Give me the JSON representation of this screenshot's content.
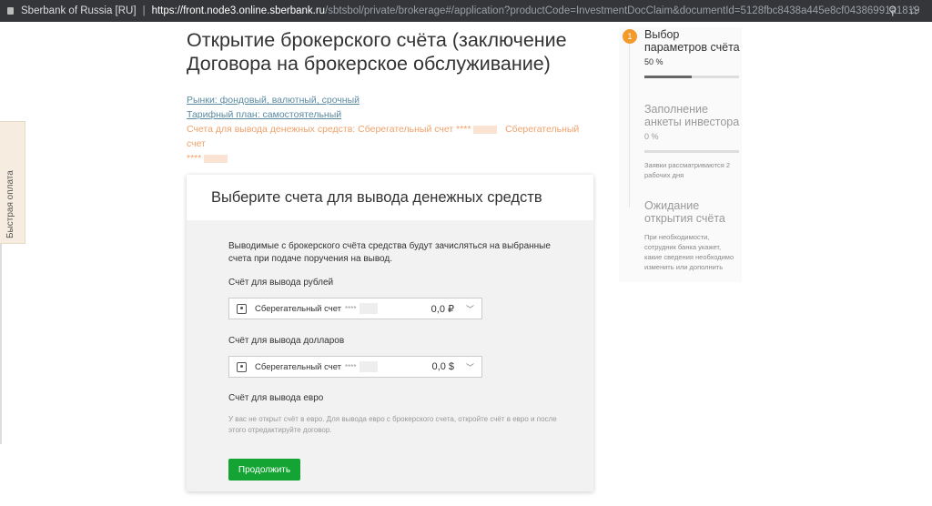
{
  "browser": {
    "site": "Sberbank of Russia [RU]",
    "url_host": "https://front.node3.online.sberbank.ru",
    "url_path": "/sbtsbol/private/brokerage#/application?productCode=InvestmentDocClaim&documentId=5128fbc8438a445e8cf04386991a1819",
    "separator": "|"
  },
  "side_tab": "Быстрая оплата",
  "page": {
    "title": "Открытие брокерского счёта (заключение Договора на брокерское обслуживание)",
    "markets_link": "Рынки: фондовый, валютный, срочный",
    "tariff_link": "Тарифный план: самостоятельный",
    "accounts_prefix": "Счета для вывода денежных средств: Сберегательный счет ****",
    "accounts_mid": "Сберегательный счет",
    "accounts_suffix": "****"
  },
  "card": {
    "title": "Выберите счета для вывода денежных средств",
    "description": "Выводимые с брокерского счёта средства будут зачисляться на выбранные счета при подаче поручения на вывод.",
    "rub_label": "Счёт для вывода рублей",
    "rub_account": "Сберегательный счет",
    "rub_stars": "****",
    "rub_amount": "0,0 ₽",
    "usd_label": "Счёт для вывода долларов",
    "usd_account": "Сберегательный счет",
    "usd_stars": "****",
    "usd_amount": "0,0 $",
    "eur_label": "Счёт для вывода евро",
    "eur_note": "У вас не открыт счёт в евро. Для вывода евро с брокерского счета, откройте счёт в евро и после этого отредактируйте договор.",
    "continue": "Продолжить"
  },
  "steps": [
    {
      "num": "1",
      "title": "Выбор параметров счёта",
      "percent": "50 %",
      "progress": 0.5
    },
    {
      "title": "Заполнение анкеты инвестора",
      "percent": "0 %",
      "progress": 0,
      "note": "Заявки рассматриваются 2 рабочих дня"
    },
    {
      "title": "Ожидание открытия счёта",
      "note": "При необходимости, сотрудник банка укажет, какие сведения необходимо изменить или дополнить"
    }
  ]
}
